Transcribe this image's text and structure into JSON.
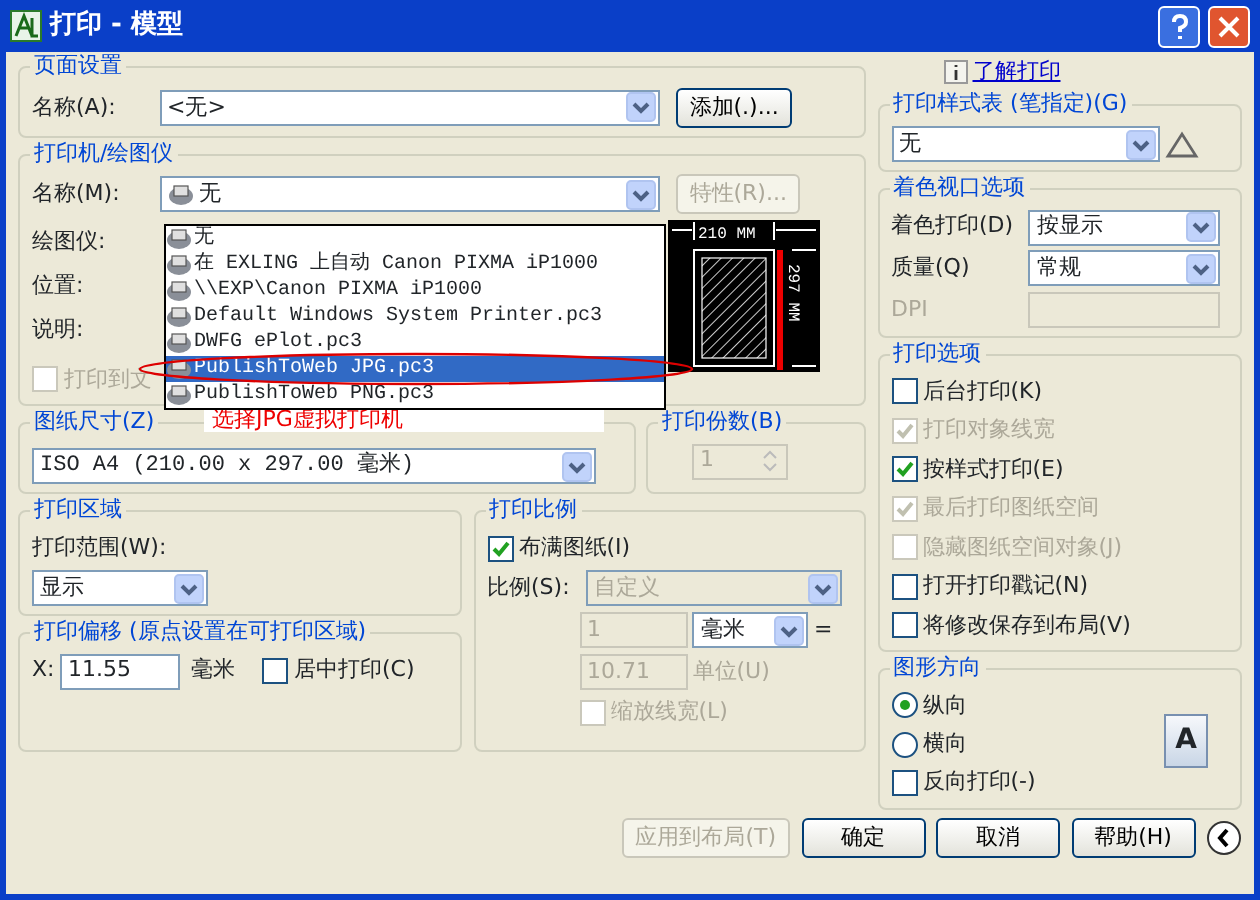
{
  "window": {
    "title": "打印 - 模型"
  },
  "help_link": "了解打印",
  "page_setup": {
    "title": "页面设置",
    "name_label": "名称(A):",
    "name_value": "<无>",
    "add_button": "添加(.)..."
  },
  "printer": {
    "title": "打印机/绘图仪",
    "name_label": "名称(M):",
    "name_value": "无",
    "properties_button": {
      "label": "特性(R)...",
      "disabled": true
    },
    "plotter_label": "绘图仪:",
    "location_label": "位置:",
    "description_label": "说明:",
    "print_to_file": {
      "label": "打印到文",
      "checked": false,
      "disabled": true
    },
    "dropdown_items": [
      {
        "label": "无",
        "selected": false
      },
      {
        "label": "在 EXLING 上自动 Canon PIXMA iP1000",
        "selected": false
      },
      {
        "label": "\\\\EXP\\Canon PIXMA iP1000",
        "selected": false
      },
      {
        "label": "Default Windows System Printer.pc3",
        "selected": false
      },
      {
        "label": "DWFG ePlot.pc3",
        "selected": false
      },
      {
        "label": "PublishToWeb JPG.pc3",
        "selected": true
      },
      {
        "label": "PublishToWeb PNG.pc3",
        "selected": false
      }
    ],
    "preview": {
      "width_text": "210 MM",
      "height_text": "297 MM"
    }
  },
  "annotation": "选择JPG虚拟打印机",
  "paper_size": {
    "title": "图纸尺寸(Z)",
    "value": "ISO A4 (210.00 x 297.00 毫米)"
  },
  "copies": {
    "title": "打印份数(B)",
    "value": "1",
    "disabled": true
  },
  "print_area": {
    "title": "打印区域",
    "range_label": "打印范围(W):",
    "range_value": "显示"
  },
  "print_offset": {
    "title": "打印偏移 (原点设置在可打印区域)",
    "x_label": "X:",
    "x_value": "11.55",
    "x_unit": "毫米",
    "center": {
      "label": "居中打印(C)",
      "checked": false
    }
  },
  "print_scale": {
    "title": "打印比例",
    "fit": {
      "label": "布满图纸(I)",
      "checked": true
    },
    "scale_label": "比例(S):",
    "scale_value": "自定义",
    "value1": "1",
    "unit1": "毫米",
    "equals": "=",
    "value2": "10.71",
    "unit2": "单位(U)",
    "lineweights": {
      "label": "缩放线宽(L)",
      "checked": false,
      "disabled": true
    }
  },
  "style_table": {
    "title": "打印样式表 (笔指定)(G)",
    "value": "无"
  },
  "shaded": {
    "title": "着色视口选项",
    "shade_label": "着色打印(D)",
    "shade_value": "按显示",
    "quality_label": "质量(Q)",
    "quality_value": "常规",
    "dpi_label": "DPI"
  },
  "print_options": {
    "title": "打印选项",
    "items": [
      {
        "label": "后台打印(K)",
        "checked": false,
        "disabled": false
      },
      {
        "label": "打印对象线宽",
        "checked": true,
        "disabled": true
      },
      {
        "label": "按样式打印(E)",
        "checked": true,
        "disabled": false
      },
      {
        "label": "最后打印图纸空间",
        "checked": true,
        "disabled": true
      },
      {
        "label": "隐藏图纸空间对象(J)",
        "checked": false,
        "disabled": true
      },
      {
        "label": "打开打印戳记(N)",
        "checked": false,
        "disabled": false
      },
      {
        "label": "将修改保存到布局(V)",
        "checked": false,
        "disabled": false
      }
    ]
  },
  "orientation": {
    "title": "图形方向",
    "radios": [
      {
        "label": "纵向",
        "selected": true
      },
      {
        "label": "横向",
        "selected": false
      }
    ],
    "upside_down": {
      "label": "反向打印(-)",
      "checked": false
    },
    "icon_letter": "A"
  },
  "buttons": [
    {
      "label": "应用到布局(T)",
      "disabled": true
    },
    {
      "label": "确定",
      "disabled": false
    },
    {
      "label": "取消",
      "disabled": false
    },
    {
      "label": "帮助(H)",
      "disabled": false
    }
  ]
}
